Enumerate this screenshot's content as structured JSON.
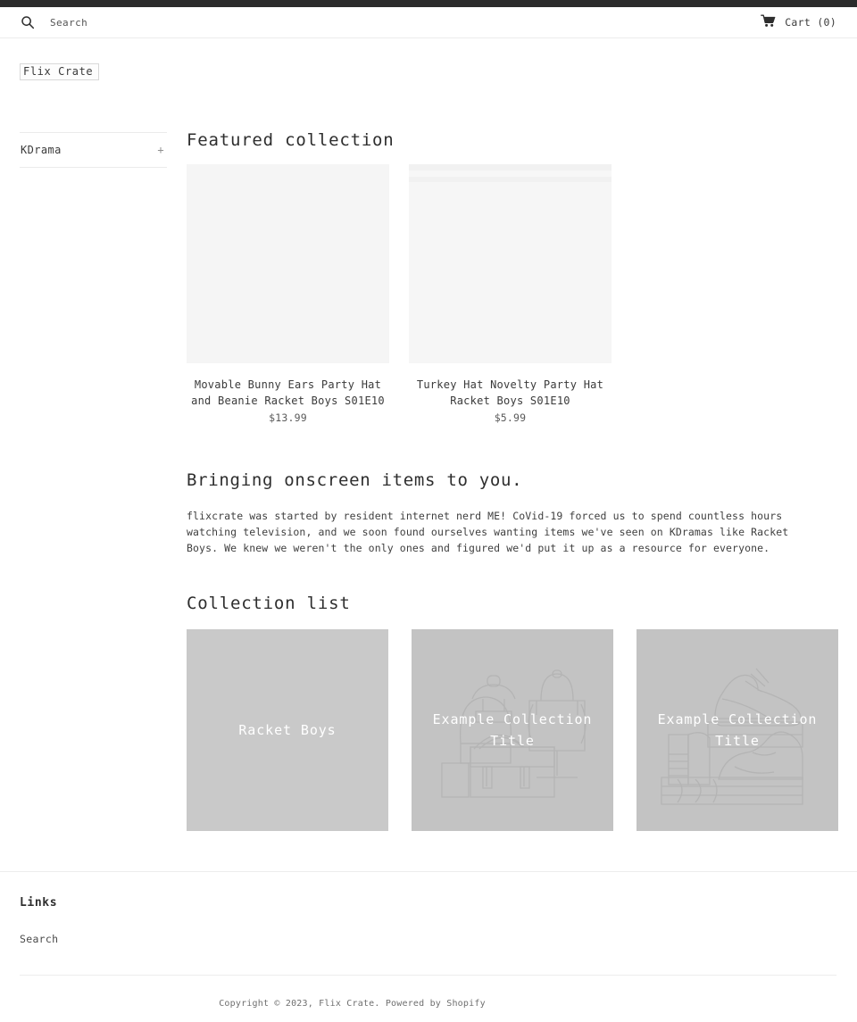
{
  "topbar": {
    "color": "#2b2b2b"
  },
  "header": {
    "search_label": "Search",
    "search_icon": "search-icon",
    "cart_icon": "shopping-cart-icon",
    "cart_label": "Cart (0)"
  },
  "logo": {
    "text": "Flix Crate"
  },
  "sidebar": {
    "items": [
      {
        "label": "KDrama",
        "expander": "+"
      }
    ]
  },
  "featured": {
    "heading": "Featured collection",
    "products": [
      {
        "title": "Movable Bunny Ears Party Hat and Beanie Racket Boys S01E10",
        "price": "$13.99",
        "image": "placeholder-light"
      },
      {
        "title": "Turkey Hat Novelty Party Hat Racket Boys S01E10",
        "price": "$5.99",
        "image": "placeholder-light-lines"
      }
    ]
  },
  "richtext": {
    "heading": "Bringing onscreen items to you.",
    "body": "flixcrate was started by resident internet nerd ME! CoVid-19 forced us to spend countless hours watching television, and we soon found ourselves wanting items we've seen on KDramas like Racket Boys. We knew we weren't the only ones and figured we'd put it up as a resource for everyone."
  },
  "collection_list": {
    "heading": "Collection list",
    "items": [
      {
        "label": "Racket Boys",
        "art": "none",
        "bg": "#c9c9c9"
      },
      {
        "label": "Example Collection Title",
        "art": "bags",
        "bg": "#c3c3c3"
      },
      {
        "label": "Example Collection Title",
        "art": "shoes",
        "bg": "#c3c3c3"
      }
    ]
  },
  "footer": {
    "heading": "Links",
    "links": [
      "Search"
    ],
    "copyright": "Copyright © 2023, Flix Crate. Powered by Shopify"
  }
}
